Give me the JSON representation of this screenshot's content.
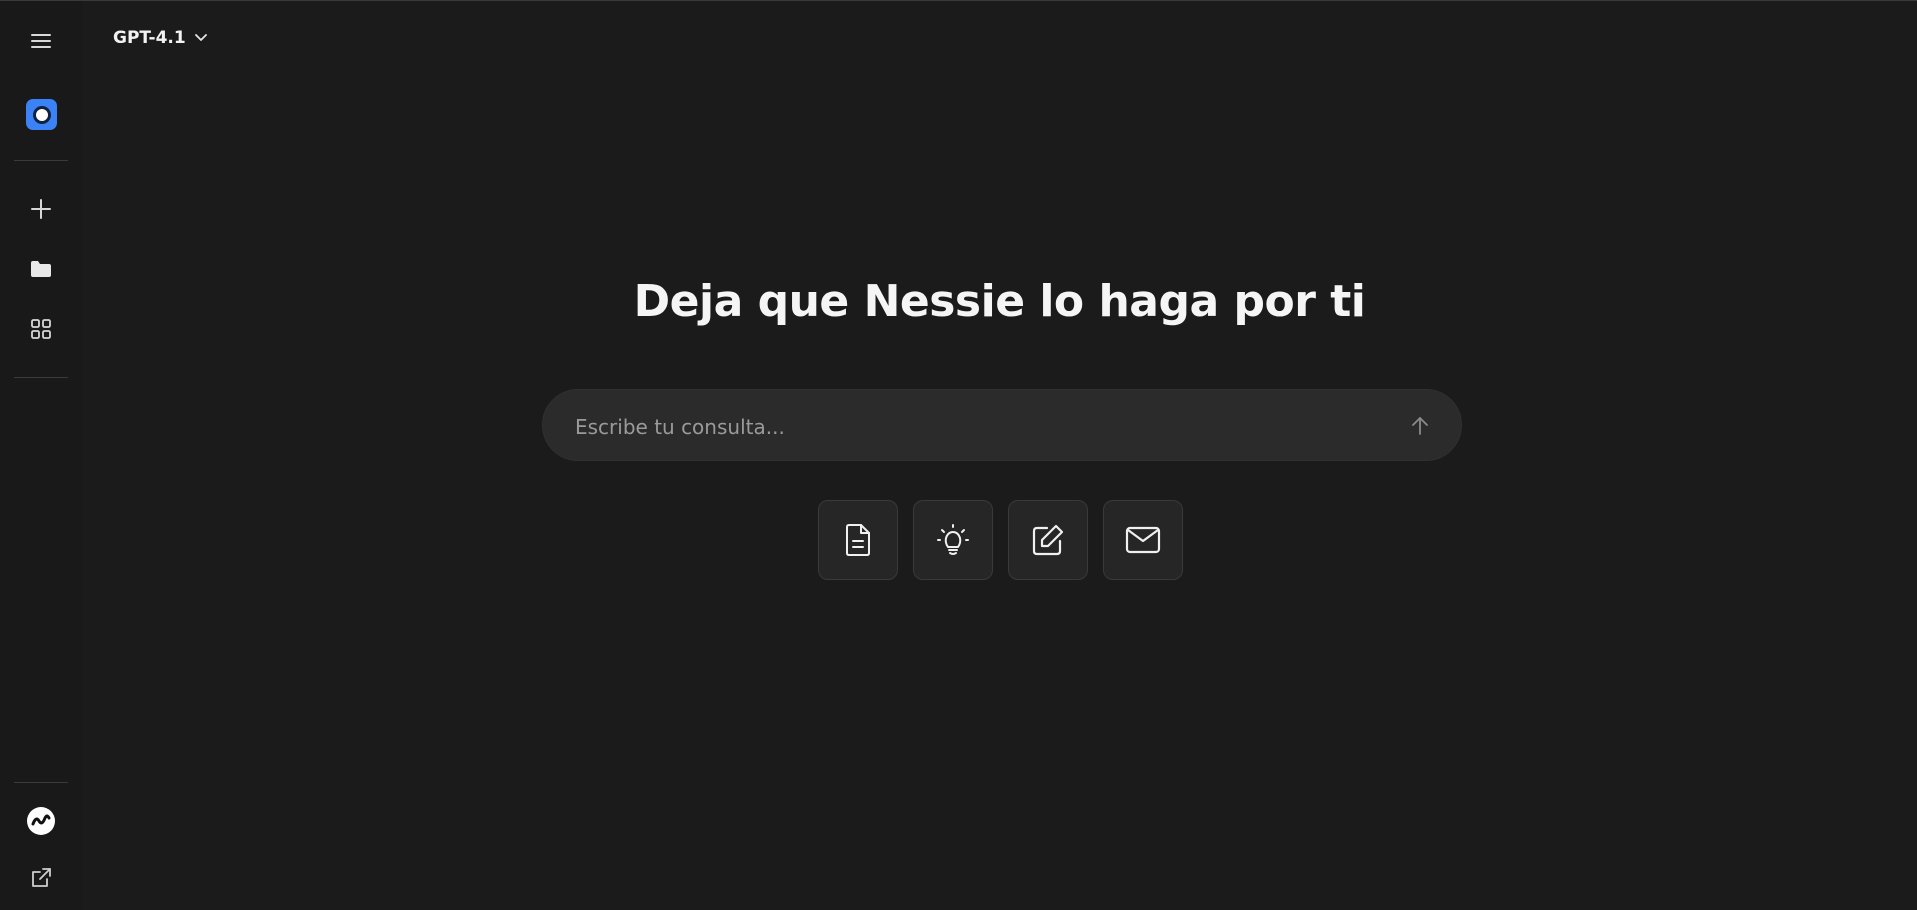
{
  "header": {
    "model_label": "GPT-4.1"
  },
  "main": {
    "headline": "Deja que Nessie lo haga por ti",
    "search": {
      "placeholder": "Escribe tu consulta...",
      "value": ""
    },
    "tools": [
      {
        "icon": "document-icon"
      },
      {
        "icon": "lightbulb-icon"
      },
      {
        "icon": "edit-icon"
      },
      {
        "icon": "mail-icon"
      }
    ]
  },
  "sidebar": {
    "items": [
      {
        "icon": "menu-icon"
      },
      {
        "icon": "app-logo"
      },
      {
        "icon": "plus-icon"
      },
      {
        "icon": "folder-icon"
      },
      {
        "icon": "grid-icon"
      },
      {
        "icon": "nessie-logo-icon"
      },
      {
        "icon": "external-link-icon"
      }
    ]
  },
  "colors": {
    "background": "#1b1b1b",
    "sidebar": "#191919",
    "accent": "#3b82f6",
    "input_bg": "#2b2b2b"
  }
}
